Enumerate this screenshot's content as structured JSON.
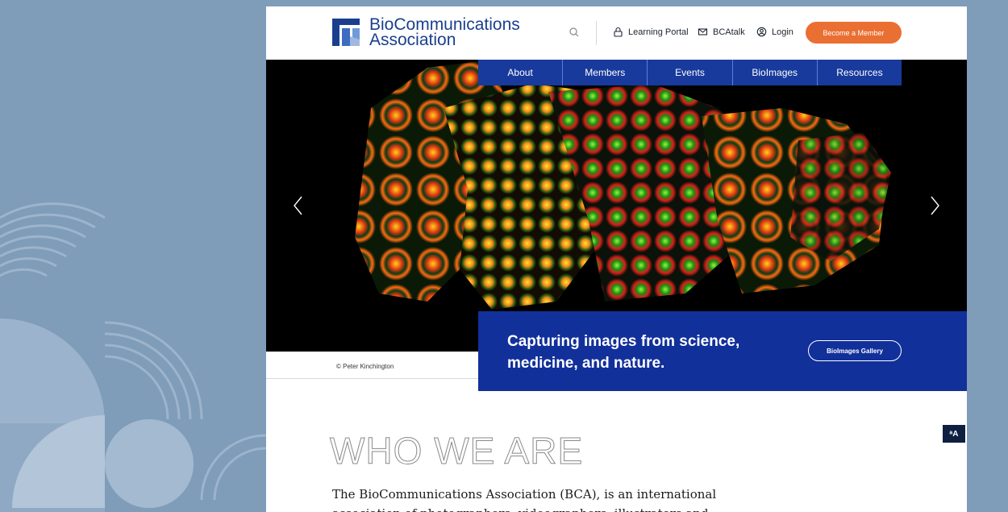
{
  "header": {
    "logo_line1": "BioCommunications",
    "logo_line2": "Association",
    "links": {
      "learning_portal": "Learning Portal",
      "bcatalk": "BCAtalk",
      "login": "Login"
    },
    "member_button": "Become a Member",
    "icons": [
      "search-icon",
      "lock-icon",
      "mail-icon",
      "user-icon"
    ]
  },
  "nav": {
    "items": [
      "About",
      "Members",
      "Events",
      "BioImages",
      "Resources"
    ]
  },
  "hero": {
    "credit": "© Peter Kinchington",
    "tagline": "Capturing images from science, medicine, and nature.",
    "gallery_button": "BioImages Gallery"
  },
  "content": {
    "title": "WHO WE ARE",
    "paragraph": "The BioCommunications Association (BCA), is an international association of photographers, videographers, illustrators and"
  },
  "accessibility_button": "ᵃA",
  "colors": {
    "brand_blue": "#12309a",
    "accent_orange": "#ea6f32",
    "page_background": "#7f9cb8"
  }
}
